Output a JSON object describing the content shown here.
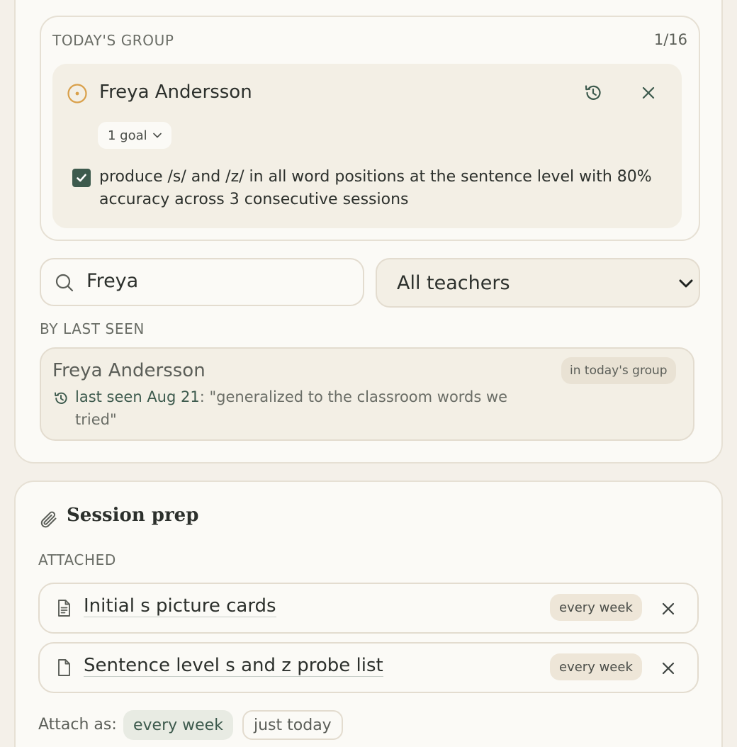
{
  "group": {
    "section_label": "TODAY'S GROUP",
    "count": "1/16",
    "student": {
      "name": "Freya Andersson",
      "goal_pill": "1 goal",
      "goal_text": "produce /s/ and /z/ in all word positions at the sentence level with 80% accuracy across 3 consecutive sessions",
      "goal_checked": true
    }
  },
  "search": {
    "value": "Freya"
  },
  "teacher_filter": {
    "selected": "All teachers"
  },
  "results": {
    "section_label": "BY LAST SEEN",
    "items": [
      {
        "name": "Freya Andersson",
        "badge": "in today's group",
        "last_seen": "last seen Aug 21",
        "note": ": \"generalized to the classroom words we tried\""
      }
    ]
  },
  "session_prep": {
    "title": "Session prep",
    "attached_label": "ATTACHED",
    "items": [
      {
        "title": "Initial s picture cards",
        "frequency": "every week",
        "icon": "document-lines-icon"
      },
      {
        "title": "Sentence level s and z probe list",
        "frequency": "every week",
        "icon": "document-blank-icon"
      }
    ],
    "attach_as_label": "Attach as:",
    "options": [
      "every week",
      "just today"
    ],
    "selected_option": "every week"
  },
  "colors": {
    "background": "#f4f0e9",
    "card": "#fbfaf6",
    "panel": "#f3efe5",
    "accent_green": "#3d5a4d",
    "status_orange": "#d9a04a",
    "border": "#e3dccf"
  }
}
